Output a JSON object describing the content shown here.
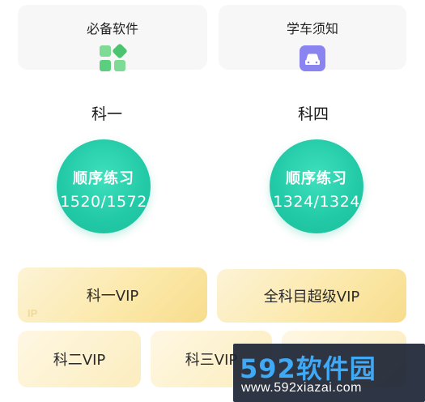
{
  "cards": [
    {
      "label": "必备软件",
      "icon": "apps-grid-icon",
      "color": "#5ccf7e"
    },
    {
      "label": "学车须知",
      "icon": "car-icon",
      "color": "#8a84f0"
    }
  ],
  "subjects": [
    {
      "title": "科一",
      "circle_title": "顺序练习",
      "progress": "1520/1572"
    },
    {
      "title": "科四",
      "circle_title": "顺序练习",
      "progress": "1324/1324"
    }
  ],
  "vip_buttons": {
    "k1": "科一VIP",
    "all": "全科目超级VIP",
    "k2": "科二VIP",
    "k3": "科三VIP",
    "k4": "",
    "badge": "IP"
  },
  "watermark": {
    "brand": "592软件园",
    "url": "www.592xiazai.com"
  },
  "colors": {
    "accent_green": "#22c9a6",
    "vip_gold": "#fbe8a8",
    "card_bg": "#f7f7f7"
  }
}
